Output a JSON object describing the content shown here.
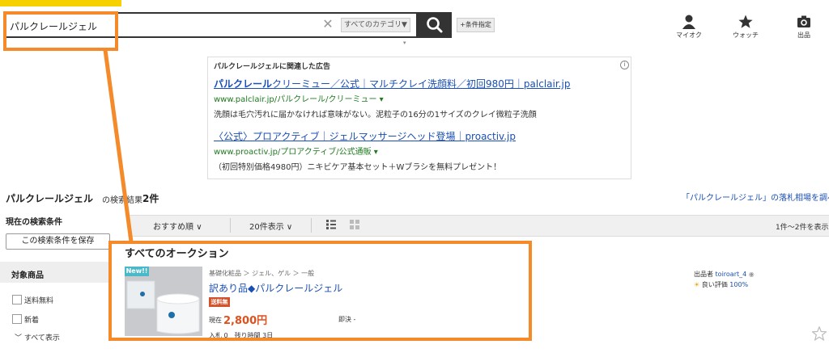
{
  "search": {
    "query": "パルクレールジェル",
    "clear_glyph": "✕",
    "category": "すべてのカテゴリ",
    "category_caret": "▼",
    "conditions_label": "+条件指定"
  },
  "header_nav": [
    {
      "label": "マイオク",
      "icon": "user-icon"
    },
    {
      "label": "ウォッチ",
      "icon": "star-icon"
    },
    {
      "label": "出品",
      "icon": "camera-icon"
    }
  ],
  "ads": {
    "heading": "パルクレールジェルに関連した広告",
    "info_glyph": "i",
    "items": [
      {
        "title_bold": "パルクレール",
        "title_rest": "クリーミュー／公式｜マルチクレイ洗顔料／初回980円｜palclair.jp",
        "url": "www.palclair.jp/パルクレール/クリーミュー",
        "desc": "洗顔は毛穴汚れに届かなければ意味がない。泥粒子の16分の1サイズのクレイ微粒子洗顔"
      },
      {
        "title_bold": "",
        "title_rest": "〈公式〉プロアクティブ｜ジェルマッサージヘッド登場｜proactiv.jp",
        "url": "www.proactiv.jp/プロアクティブ/公式通販",
        "desc": "（初回特別価格4980円）ニキビケア基本セット＋Wブラシを無料プレゼント！"
      }
    ]
  },
  "results": {
    "keyword": "パルクレールジェル",
    "suffix": "の検索結果",
    "count": "2件",
    "market_link": "「パルクレールジェル」の落札相場を調べる"
  },
  "sidebar": {
    "current_conditions": "現在の検索条件",
    "save_button": "この検索条件を保存",
    "target_label": "対象商品",
    "filters": [
      "送料無料",
      "新着"
    ],
    "show_all": "すべて表示"
  },
  "toolbar": {
    "sort": "おすすめ順",
    "per_page": "20件表示",
    "range": "1件〜2件を表示"
  },
  "section_title": "すべてのオークション",
  "item": {
    "new_badge": "New!!",
    "breadcrumb": "基礎化粧品 ＞ ジェル、ゲル ＞ 一般",
    "title": "訳あり品◆パルクレールジェル",
    "shipping_badge": "送料無料",
    "price_label": "現在",
    "price": "2,800円",
    "buyout_label": "即決 -",
    "bids_text": "入札 0　残り時間 3日",
    "seller_label": "出品者",
    "seller_name": "toiroart_4",
    "rating_label": "良い評価",
    "rating_value": "100%"
  },
  "colors": {
    "accent_orange": "#f58a2a",
    "link_blue": "#1a4fb5",
    "price_red": "#e0501d",
    "url_green": "#1f7a1f"
  }
}
